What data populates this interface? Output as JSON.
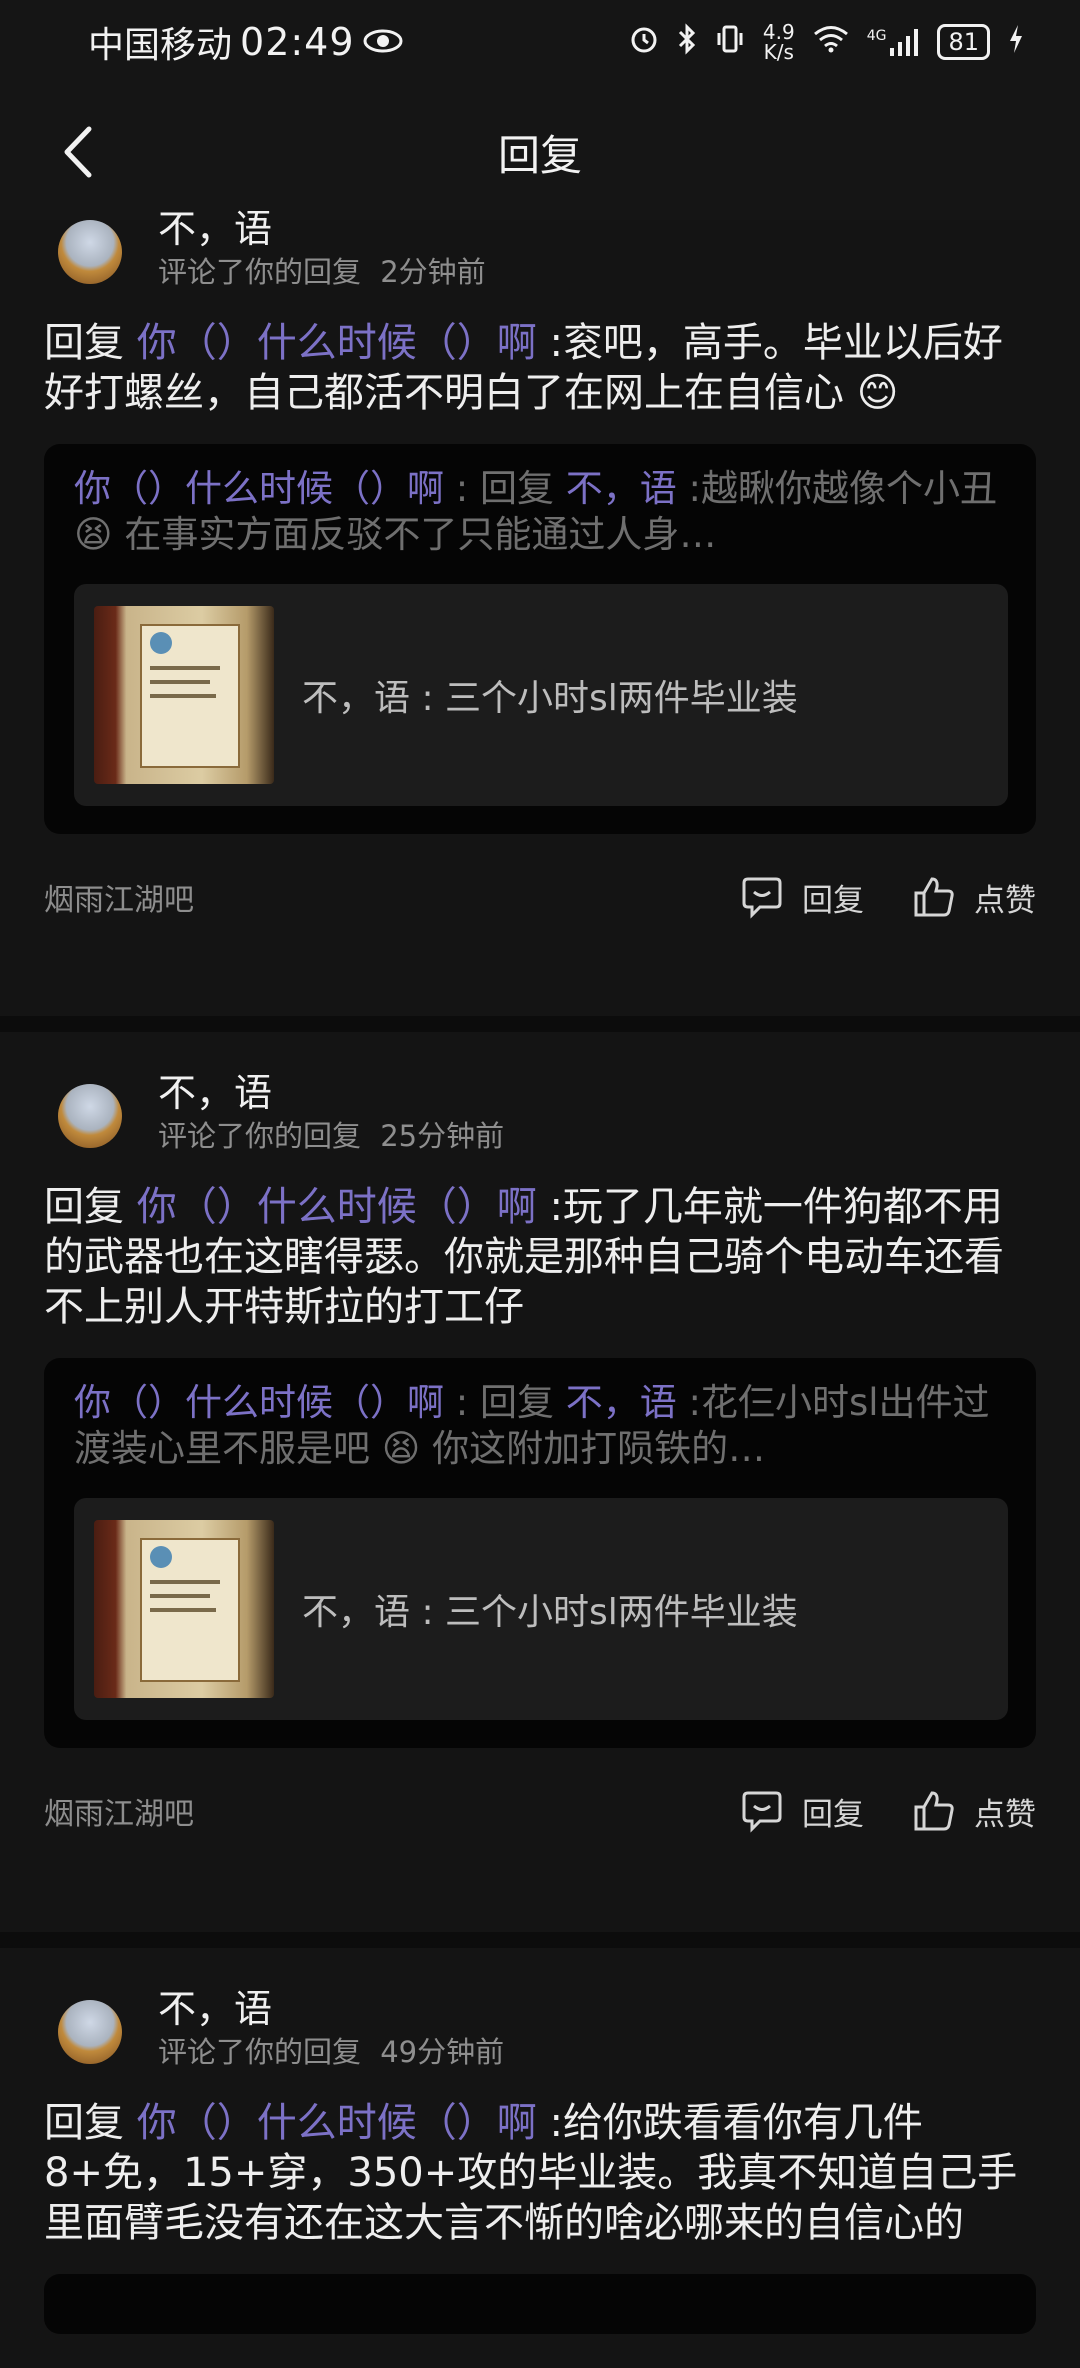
{
  "status_bar": {
    "carrier": "中国移动",
    "time": "02:49",
    "net_speed_value": "4.9",
    "net_speed_unit": "K/s",
    "signal_label": "4G",
    "battery": "81"
  },
  "header": {
    "title": "回复"
  },
  "comments": [
    {
      "author": "不，语",
      "action": "评论了你的回复",
      "time": "2分钟前",
      "reply_prefix": "回复",
      "reply_target": "你（）什么时候（）啊",
      "reply_body": ":衮吧，高手。毕业以后好好打螺丝，自己都活不明白了在网上在自信心",
      "emoji": "😊",
      "quote_user": "你（）什么时候（）啊",
      "quote_sep": ": 回复",
      "quote_target": "不，语",
      "quote_body": ":越瞅你越像个小丑",
      "quote_emoji": "😫",
      "quote_body2": "在事实方面反驳不了只能通过人身…",
      "thread_text": "不，语 : 三个小时sl两件毕业装",
      "forum": "烟雨江湖吧",
      "reply_label": "回复",
      "like_label": "点赞"
    },
    {
      "author": "不，语",
      "action": "评论了你的回复",
      "time": "25分钟前",
      "reply_prefix": "回复",
      "reply_target": "你（）什么时候（）啊",
      "reply_body": ":玩了几年就一件狗都不用的武器也在这瞎得瑟。你就是那种自己骑个电动车还看不上别人开特斯拉的打工仔",
      "emoji": "",
      "quote_user": "你（）什么时候（）啊",
      "quote_sep": ": 回复",
      "quote_target": "不，语",
      "quote_body": ":花仨小时sl出件过渡装心里不服是吧",
      "quote_emoji": "😫",
      "quote_body2": "你这附加打陨铁的…",
      "thread_text": "不，语 : 三个小时sl两件毕业装",
      "forum": "烟雨江湖吧",
      "reply_label": "回复",
      "like_label": "点赞"
    },
    {
      "author": "不，语",
      "action": "评论了你的回复",
      "time": "49分钟前",
      "reply_prefix": "回复",
      "reply_target": "你（）什么时候（）啊",
      "reply_body": ":给你跌看看你有几件8+免，15+穿，350+攻的毕业装。我真不知道自己手里面臂毛没有还在这大言不惭的啥必哪来的自信心的",
      "emoji": ""
    }
  ]
}
